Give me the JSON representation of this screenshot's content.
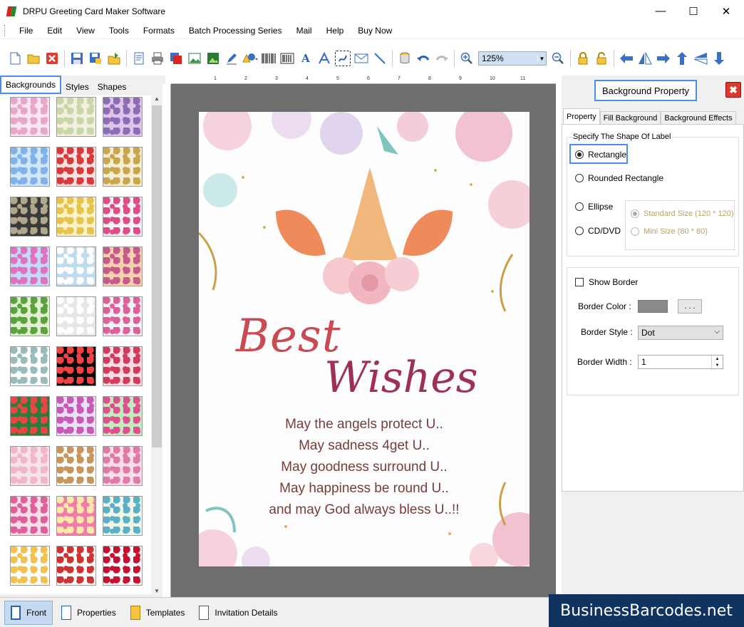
{
  "window": {
    "title": "DRPU Greeting Card Maker Software",
    "minimize": "—",
    "maximize": "☐",
    "close": "✕"
  },
  "menu": [
    "File",
    "Edit",
    "View",
    "Tools",
    "Formats",
    "Batch Processing Series",
    "Mail",
    "Help",
    "Buy Now"
  ],
  "toolbar": {
    "zoom_value": "125%"
  },
  "left_panel": {
    "tabs": [
      "Backgrounds",
      "Styles",
      "Shapes"
    ],
    "active_tab": "Backgrounds",
    "thumbnail_count": 30
  },
  "card": {
    "line1": "Best",
    "line2": "Wishes",
    "verses": [
      "May the angels protect U..",
      "May sadness 4get U..",
      "May goodness surround U..",
      "May happiness be round U..",
      "and may God always bless U..!!"
    ]
  },
  "right_panel": {
    "title": "Background Property",
    "close_label": "✖",
    "tabs": [
      "Property",
      "Fill Background",
      "Background Effects"
    ],
    "active_tab": "Property",
    "shape_group_label": "Specify The Shape Of Label",
    "shapes": [
      "Rectangle",
      "Rounded Rectangle",
      "Ellipse",
      "CD/DVD"
    ],
    "selected_shape": "Rectangle",
    "sizes": [
      "Standard Size (120 * 120)",
      "Mini Size (80 * 80)"
    ],
    "show_border_label": "Show Border",
    "show_border_checked": false,
    "border_color_label": "Border Color :",
    "border_color": "#8a8a8a",
    "border_color_button": ". . .",
    "border_style_label": "Border Style :",
    "border_style_value": "Dot",
    "border_width_label": "Border Width :",
    "border_width_value": "1"
  },
  "bottom_tabs": [
    "Front",
    "Properties",
    "Templates",
    "Invitation Details"
  ],
  "active_bottom_tab": "Front",
  "brand": "BusinessBarcodes.net",
  "ruler_marks": [
    "1",
    "2",
    "3",
    "4",
    "5",
    "6",
    "7",
    "8",
    "9",
    "10",
    "11"
  ],
  "colors": {
    "accent_blue": "#4a90e2",
    "best_text": "#c94a52",
    "wishes_text": "#9e2f55",
    "verse_text": "#7a3b3b",
    "brand_bg": "#10345f"
  }
}
